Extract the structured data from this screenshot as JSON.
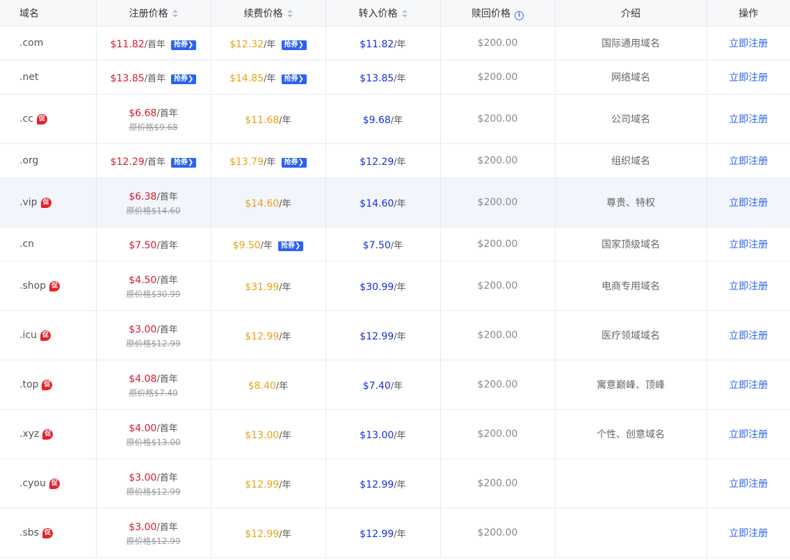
{
  "headers": {
    "name": "域名",
    "register": "注册价格",
    "renew": "续费价格",
    "transfer": "转入价格",
    "redeem": "赎回价格",
    "info_icon": "i",
    "desc": "介绍",
    "action": "操作"
  },
  "labels": {
    "first_year": "/首年",
    "per_year": "/年",
    "coupon": "抢券",
    "coupon_arrow": "❯",
    "promo": "促",
    "register_link": "立即注册"
  },
  "rows": [
    {
      "name": ".com",
      "reg": "$11.82",
      "reg_coupon": true,
      "renew": "$12.32",
      "renew_coupon": true,
      "transfer": "$11.82",
      "redeem": "$200.00",
      "desc": "国际通用域名"
    },
    {
      "name": ".net",
      "reg": "$13.85",
      "reg_coupon": true,
      "renew": "$14.85",
      "renew_coupon": true,
      "transfer": "$13.85",
      "redeem": "$200.00",
      "desc": "网络域名"
    },
    {
      "name": ".cc",
      "promo": true,
      "reg": "$6.68",
      "orig": "原价格$9.68",
      "renew": "$11.68",
      "transfer": "$9.68",
      "redeem": "$200.00",
      "desc": "公司域名"
    },
    {
      "name": ".org",
      "reg": "$12.29",
      "reg_coupon": true,
      "renew": "$13.79",
      "renew_coupon": true,
      "transfer": "$12.29",
      "redeem": "$200.00",
      "desc": "组织域名"
    },
    {
      "name": ".vip",
      "promo": true,
      "reg": "$6.38",
      "orig": "原价格$14.60",
      "renew": "$14.60",
      "transfer": "$14.60",
      "redeem": "$200.00",
      "desc": "尊贵、特权",
      "highlight": true
    },
    {
      "name": ".cn",
      "reg": "$7.50",
      "renew": "$9.50",
      "renew_coupon": true,
      "transfer": "$7.50",
      "redeem": "$200.00",
      "desc": "国家顶级域名"
    },
    {
      "name": ".shop",
      "promo": true,
      "reg": "$4.50",
      "orig": "原价格$30.99",
      "renew": "$31.99",
      "transfer": "$30.99",
      "redeem": "$200.00",
      "desc": "电商专用域名"
    },
    {
      "name": ".icu",
      "promo": true,
      "reg": "$3.00",
      "orig": "原价格$12.99",
      "renew": "$12.99",
      "transfer": "$12.99",
      "redeem": "$200.00",
      "desc": "医疗领域域名"
    },
    {
      "name": ".top",
      "promo": true,
      "reg": "$4.08",
      "orig": "原价格$7.40",
      "renew": "$8.40",
      "transfer": "$7.40",
      "redeem": "$200.00",
      "desc": "寓意巅峰、顶峰"
    },
    {
      "name": ".xyz",
      "promo": true,
      "reg": "$4.00",
      "orig": "原价格$13.00",
      "renew": "$13.00",
      "transfer": "$13.00",
      "redeem": "$200.00",
      "desc": "个性、创意域名"
    },
    {
      "name": ".cyou",
      "promo": true,
      "reg": "$3.00",
      "orig": "原价格$12.99",
      "renew": "$12.99",
      "transfer": "$12.99",
      "redeem": "$200.00",
      "desc": ""
    },
    {
      "name": ".sbs",
      "promo": true,
      "reg": "$3.00",
      "orig": "原价格$12.99",
      "renew": "$12.99",
      "transfer": "$12.99",
      "redeem": "$200.00",
      "desc": ""
    }
  ]
}
